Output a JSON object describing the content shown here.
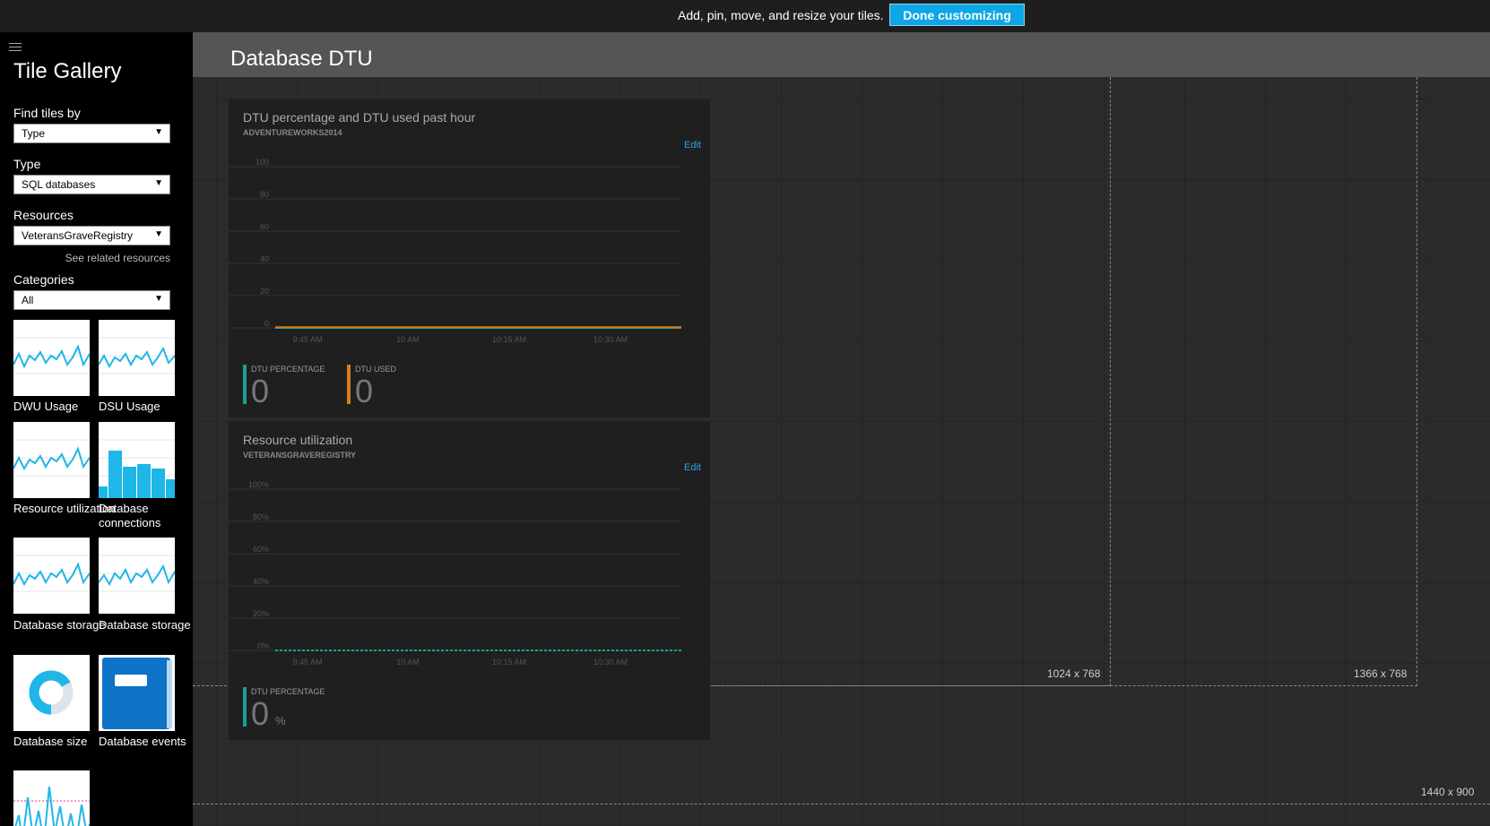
{
  "topbar": {
    "message": "Add, pin, move, and resize your tiles.",
    "done_label": "Done customizing"
  },
  "sidebar": {
    "title": "Tile Gallery",
    "find_by": {
      "label": "Find tiles by",
      "value": "Type"
    },
    "type": {
      "label": "Type",
      "value": "SQL databases"
    },
    "resources": {
      "label": "Resources",
      "value": "VeteransGraveRegistry",
      "related_link": "See related resources"
    },
    "categories": {
      "label": "Categories",
      "value": "All"
    },
    "tiles": [
      {
        "caption": "DWU Usage",
        "icon": "line-chart-icon"
      },
      {
        "caption": "DSU Usage",
        "icon": "line-chart-icon"
      },
      {
        "caption": "Resource utilization",
        "icon": "line-chart-icon"
      },
      {
        "caption": "Database connections",
        "icon": "bar-chart-icon"
      },
      {
        "caption": "Database storage",
        "icon": "line-chart-icon"
      },
      {
        "caption": "Database storage",
        "icon": "line-chart-icon"
      },
      {
        "caption": "Database size",
        "icon": "donut-chart-icon"
      },
      {
        "caption": "Database events",
        "icon": "book-icon"
      },
      {
        "caption": "",
        "icon": "spike-chart-icon"
      }
    ]
  },
  "main": {
    "title": "Database DTU",
    "resolutions": [
      "1024 x 768",
      "1366 x 768",
      "1440 x 900"
    ],
    "tile1": {
      "title": "DTU percentage and DTU used past hour",
      "subtitle": "ADVENTUREWORKS2014",
      "edit": "Edit",
      "metrics": [
        {
          "label": "DTU PERCENTAGE",
          "value": "0",
          "color": "#1b9e94"
        },
        {
          "label": "DTU USED",
          "value": "0",
          "color": "#d57f1b"
        }
      ]
    },
    "tile2": {
      "title": "Resource utilization",
      "subtitle": "VETERANSGRAVEREGISTRY",
      "edit": "Edit",
      "metrics": [
        {
          "label": "DTU PERCENTAGE",
          "value": "0",
          "unit": "%",
          "color": "#1b9e94"
        }
      ]
    }
  },
  "chart_data": [
    {
      "type": "line",
      "x": [
        "9:45 AM",
        "10 AM",
        "10:15 AM",
        "10:30 AM"
      ],
      "ylim": [
        0,
        100
      ],
      "yticks": [
        "0",
        "20",
        "40",
        "60",
        "80",
        "100"
      ],
      "series": [
        {
          "name": "DTU PERCENTAGE",
          "values": [
            0,
            0,
            0,
            0
          ]
        },
        {
          "name": "DTU USED",
          "values": [
            0,
            0,
            0,
            0
          ]
        }
      ]
    },
    {
      "type": "line",
      "x": [
        "9:45 AM",
        "10 AM",
        "10:15 AM",
        "10:30 AM"
      ],
      "ylim": [
        0,
        100
      ],
      "yticks": [
        "0%",
        "20%",
        "40%",
        "60%",
        "80%",
        "100%"
      ],
      "series": [
        {
          "name": "DTU PERCENTAGE",
          "values": [
            0,
            0,
            0,
            0
          ]
        }
      ]
    }
  ]
}
